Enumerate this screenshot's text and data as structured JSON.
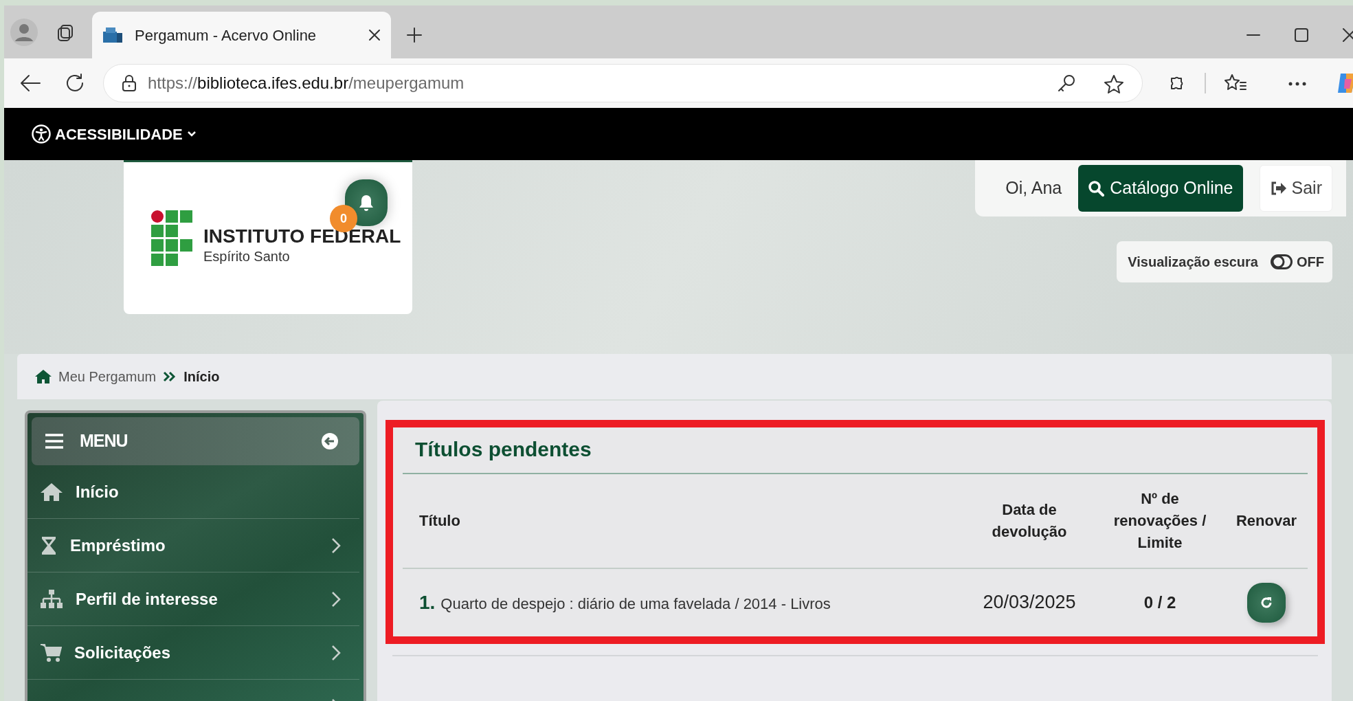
{
  "browser": {
    "tab_title": "Pergamum - Acervo Online",
    "url": "https://**biblioteca.ifes.edu.br**/meupergamum"
  },
  "accessibility": {
    "label": "ACESSIBILIDADE"
  },
  "logo": {
    "name": "INSTITUTO FEDERAL",
    "subtitle": "Espírito Santo"
  },
  "notifications": {
    "count": "0"
  },
  "user_bar": {
    "greeting": "Oi, Ana",
    "catalog_button": "Catálogo Online",
    "logout_button": "Sair"
  },
  "dark_mode": {
    "label": "Visualização escura",
    "on": false,
    "state_text": "OFF"
  },
  "breadcrumb": [
    {
      "label": "Meu Pergamum",
      "current": false
    },
    {
      "label": "Início",
      "current": true
    }
  ],
  "sidebar": {
    "title": "MENU",
    "items": [
      {
        "label": "Início",
        "has_submenu": false
      },
      {
        "label": "Empréstimo",
        "has_submenu": true
      },
      {
        "label": "Perfil de interesse",
        "has_submenu": true
      },
      {
        "label": "Solicitações",
        "has_submenu": true
      },
      {
        "has_submenu": true
      }
    ]
  },
  "pending": {
    "title": "Títulos pendentes",
    "columns": [
      "Título",
      "Data de devolução",
      "Nº de renovações / Limite",
      "Renovar"
    ],
    "rows": [
      {
        "number": "1.",
        "title": "Quarto de despejo : diário de uma favelada / 2014 - Livros",
        "due_date": "20/03/2025",
        "renewals": "0 / 2"
      }
    ]
  }
}
